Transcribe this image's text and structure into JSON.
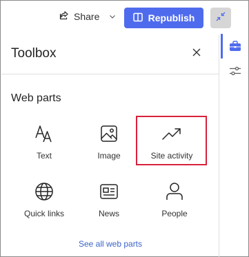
{
  "topbar": {
    "share_label": "Share",
    "republish_label": "Republish",
    "accent": "#4f6bed"
  },
  "toolbox": {
    "title": "Toolbox",
    "section_title": "Web parts",
    "tiles": [
      {
        "label": "Text",
        "icon": "text-icon"
      },
      {
        "label": "Image",
        "icon": "image-icon"
      },
      {
        "label": "Site activity",
        "icon": "trend-chart-icon",
        "highlighted": true
      },
      {
        "label": "Quick links",
        "icon": "globe-icon"
      },
      {
        "label": "News",
        "icon": "news-icon"
      },
      {
        "label": "People",
        "icon": "person-icon"
      }
    ],
    "see_all_label": "See all web parts",
    "highlight_color": "#d8213b"
  },
  "rail": {
    "items": [
      {
        "icon": "toolbox-icon",
        "active": true
      },
      {
        "icon": "settings-sliders-icon",
        "active": false
      }
    ]
  }
}
